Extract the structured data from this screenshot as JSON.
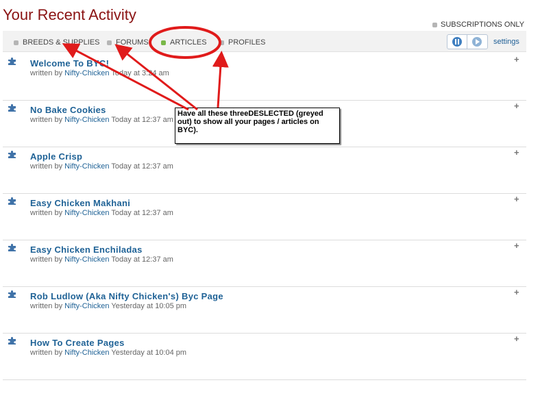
{
  "header": {
    "title": "Your Recent Activity"
  },
  "subscriptions": {
    "label": "SUBSCRIPTIONS ONLY"
  },
  "tabs": [
    {
      "label": "BREEDS & SUPPLIES"
    },
    {
      "label": "FORUMS"
    },
    {
      "label": "ARTICLES"
    },
    {
      "label": "PROFILES"
    }
  ],
  "controls": {
    "settings_label": "settings"
  },
  "items": [
    {
      "title": "Welcome To BYC!",
      "written_by": "written by",
      "author": "Nifty-Chicken",
      "time": "Today at 3:24 am"
    },
    {
      "title": "No Bake Cookies",
      "written_by": "written by",
      "author": "Nifty-Chicken",
      "time": "Today at 12:37 am"
    },
    {
      "title": "Apple Crisp",
      "written_by": "written by",
      "author": "Nifty-Chicken",
      "time": "Today at 12:37 am"
    },
    {
      "title": "Easy Chicken Makhani",
      "written_by": "written by",
      "author": "Nifty-Chicken",
      "time": "Today at 12:37 am"
    },
    {
      "title": "Easy Chicken Enchiladas",
      "written_by": "written by",
      "author": "Nifty-Chicken",
      "time": "Today at 12:37 am"
    },
    {
      "title": "Rob Ludlow (Aka Nifty Chicken's) Byc Page",
      "written_by": "written by",
      "author": "Nifty-Chicken",
      "time": "Yesterday at 10:05 pm"
    },
    {
      "title": "How To Create Pages",
      "written_by": "written by",
      "author": "Nifty-Chicken",
      "time": "Yesterday at 10:04 pm"
    }
  ],
  "annotation": {
    "text": "Have all these threeDESLECTED (greyed out) to show all your pages / articles on BYC).",
    "color": "#e01b1b"
  },
  "colors": {
    "title": "#8a1212",
    "link": "#1f6296",
    "active_dot": "#79b748",
    "inactive_dot": "#b5b5b5"
  }
}
